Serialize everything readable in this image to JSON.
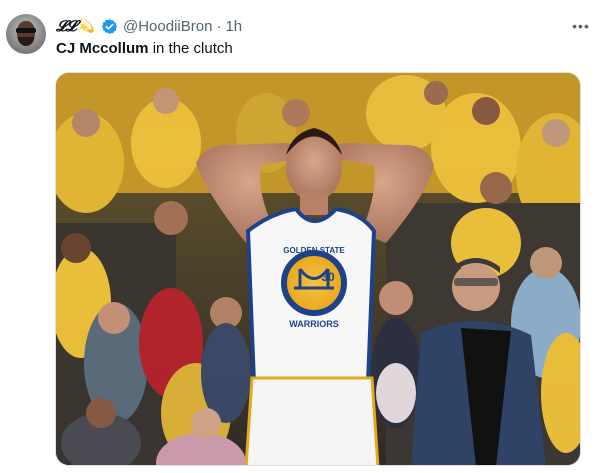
{
  "tweet": {
    "author_name": "𝓛𝓛",
    "author_emoji": "💫",
    "handle": "@HoodiiBron",
    "separator": "·",
    "time": "1h",
    "text_bold": "CJ Mccollum",
    "text_rest": " in the clutch",
    "more_label": "•••",
    "jersey_team_text": "GOLDEN STATE",
    "jersey_number": "30",
    "jersey_name": "WARRIORS"
  },
  "colors": {
    "verified": "#1d9bf0",
    "crowd_yellow": "#f2c53c",
    "jersey_blue": "#1d428a"
  },
  "icons": {
    "verified": "verified-badge-icon",
    "more": "more-options-icon"
  }
}
